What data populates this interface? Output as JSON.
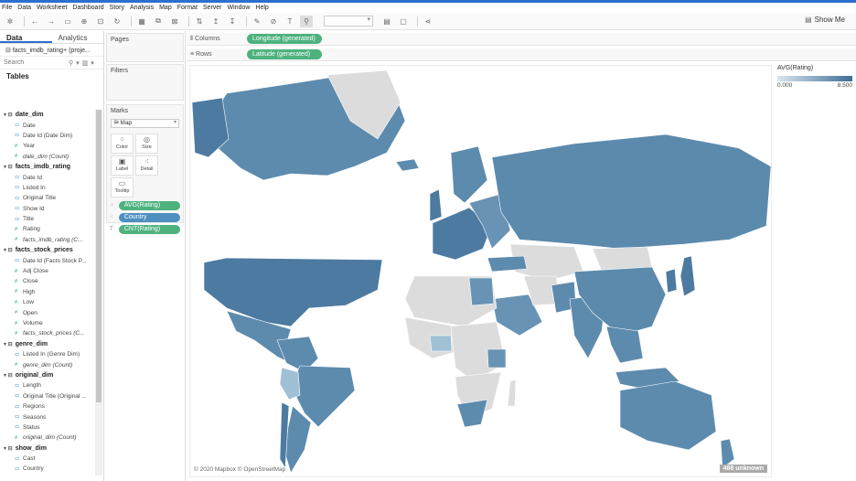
{
  "menu": [
    "File",
    "Data",
    "Worksheet",
    "Dashboard",
    "Story",
    "Analysis",
    "Map",
    "Format",
    "Server",
    "Window",
    "Help"
  ],
  "toolbar": {
    "show_me_label": "Show Me"
  },
  "left_tabs": {
    "data": "Data",
    "analytics": "Analytics"
  },
  "datasource": "facts_imdb_rating+ (proje...",
  "search": {
    "placeholder": "Search"
  },
  "tables_heading": "Tables",
  "tree": [
    {
      "kind": "group",
      "label": "date_dim"
    },
    {
      "kind": "dim",
      "label": "Date"
    },
    {
      "kind": "dim",
      "label": "Date Id (Date Dim)"
    },
    {
      "kind": "meas",
      "label": "Year"
    },
    {
      "kind": "meas-it",
      "label": "date_dim (Count)"
    },
    {
      "kind": "group",
      "label": "facts_imdb_rating"
    },
    {
      "kind": "dim",
      "label": "Date Id"
    },
    {
      "kind": "dim",
      "label": "Listed In"
    },
    {
      "kind": "dim",
      "label": "Original Title"
    },
    {
      "kind": "dim",
      "label": "Show Id"
    },
    {
      "kind": "dim",
      "label": "Title"
    },
    {
      "kind": "meas",
      "label": "Rating"
    },
    {
      "kind": "meas-it",
      "label": "facts_imdb_rating (C..."
    },
    {
      "kind": "group",
      "label": "facts_stock_prices"
    },
    {
      "kind": "dim",
      "label": "Date Id (Facts Stock P..."
    },
    {
      "kind": "meas",
      "label": "Adj Close"
    },
    {
      "kind": "meas",
      "label": "Close"
    },
    {
      "kind": "meas",
      "label": "High"
    },
    {
      "kind": "meas",
      "label": "Low"
    },
    {
      "kind": "meas",
      "label": "Open"
    },
    {
      "kind": "meas",
      "label": "Volume"
    },
    {
      "kind": "meas-it",
      "label": "facts_stock_prices (C..."
    },
    {
      "kind": "group",
      "label": "genre_dim"
    },
    {
      "kind": "dim",
      "label": "Listed In (Genre Dim)"
    },
    {
      "kind": "meas-it",
      "label": "genre_dim (Count)"
    },
    {
      "kind": "group",
      "label": "original_dim"
    },
    {
      "kind": "dim",
      "label": "Length"
    },
    {
      "kind": "dim",
      "label": "Original Title (Original ..."
    },
    {
      "kind": "dim",
      "label": "Regions"
    },
    {
      "kind": "dim",
      "label": "Seasons"
    },
    {
      "kind": "dim",
      "label": "Status"
    },
    {
      "kind": "meas-it",
      "label": "original_dim (Count)"
    },
    {
      "kind": "group",
      "label": "show_dim"
    },
    {
      "kind": "dim",
      "label": "Cast"
    },
    {
      "kind": "dim",
      "label": "Country"
    }
  ],
  "cards": {
    "pages": "Pages",
    "filters": "Filters",
    "marks": "Marks",
    "mark_type": "Map",
    "buttons": [
      "Color",
      "Size",
      "Label",
      "Detail",
      "Tooltip"
    ],
    "pills": [
      {
        "label": "AVG(Rating)",
        "kind": "meas",
        "icon": "color-icon"
      },
      {
        "label": "Country",
        "kind": "dim",
        "icon": "detail-icon"
      },
      {
        "label": "CNT(Rating)",
        "kind": "meas",
        "icon": "label-icon"
      }
    ]
  },
  "shelves": {
    "columns_label": "Columns",
    "columns_pill": "Longitude (generated)",
    "rows_label": "Rows",
    "rows_pill": "Latitude (generated)"
  },
  "map": {
    "copyright": "© 2020 Mapbox © OpenStreetMap",
    "unknown_badge": "488 unknown",
    "fill_color": "#5b8aad",
    "nodata_color": "#dcdcdc"
  },
  "legend": {
    "title": "AVG(Rating)",
    "min": "0.000",
    "max": "8.500",
    "color_low": "#d9e6ee",
    "color_high": "#3e6e95"
  }
}
